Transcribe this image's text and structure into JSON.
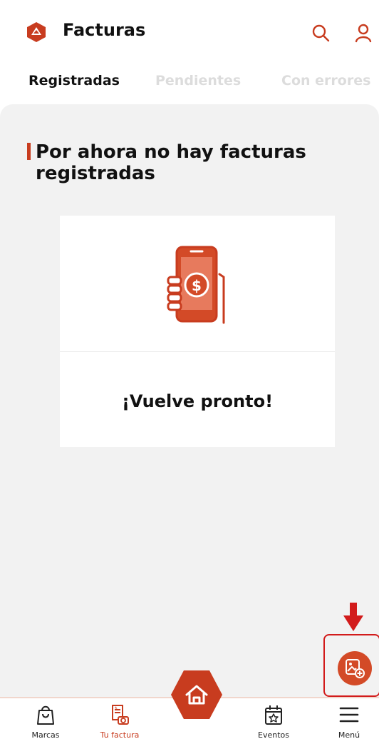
{
  "header": {
    "title": "Facturas",
    "logo_icon": "brand-logo-icon",
    "actions": [
      "search-icon",
      "user-icon"
    ]
  },
  "tabs": [
    {
      "label": "Registradas",
      "state": "active"
    },
    {
      "label": "Pendientes",
      "state": "inactive"
    },
    {
      "label": "Con errores",
      "state": "inactive"
    }
  ],
  "empty_state": {
    "heading": "Por ahora no hay facturas registradas",
    "illustration_icon": "phone-payment-icon",
    "message": "¡Vuelve pronto!"
  },
  "fab": {
    "icon": "add-photo-icon"
  },
  "annotation": {
    "arrow": "down-arrow",
    "color": "#d21b1b"
  },
  "bottom_nav": {
    "items": [
      {
        "label": "Marcas",
        "icon": "shopping-bag-icon",
        "active": false
      },
      {
        "label": "Tu factura",
        "icon": "invoice-camera-icon",
        "active": true
      },
      {
        "label": "",
        "icon": "home-icon",
        "active": false
      },
      {
        "label": "Eventos",
        "icon": "calendar-star-icon",
        "active": false
      },
      {
        "label": "Menú",
        "icon": "menu-icon",
        "active": false
      }
    ]
  },
  "colors": {
    "accent": "#c83c1f",
    "background": "#f2f2f2",
    "tab_inactive": "#dcdcdc"
  }
}
